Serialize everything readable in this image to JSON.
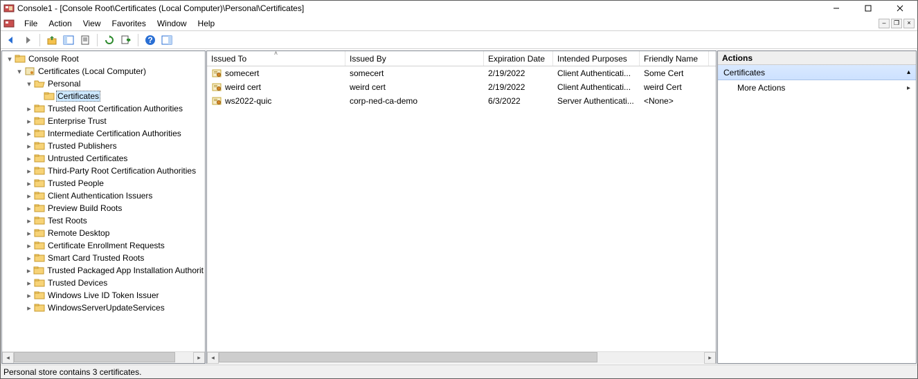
{
  "window": {
    "title": "Console1 - [Console Root\\Certificates (Local Computer)\\Personal\\Certificates]"
  },
  "menu": {
    "file": "File",
    "action": "Action",
    "view": "View",
    "favorites": "Favorites",
    "window": "Window",
    "help": "Help"
  },
  "tree": {
    "root": "Console Root",
    "certs_local": "Certificates (Local Computer)",
    "personal": "Personal",
    "certificates": "Certificates",
    "nodes": [
      "Trusted Root Certification Authorities",
      "Enterprise Trust",
      "Intermediate Certification Authorities",
      "Trusted Publishers",
      "Untrusted Certificates",
      "Third-Party Root Certification Authorities",
      "Trusted People",
      "Client Authentication Issuers",
      "Preview Build Roots",
      "Test Roots",
      "Remote Desktop",
      "Certificate Enrollment Requests",
      "Smart Card Trusted Roots",
      "Trusted Packaged App Installation Authorit",
      "Trusted Devices",
      "Windows Live ID Token Issuer",
      "WindowsServerUpdateServices"
    ]
  },
  "columns": {
    "issued_to": "Issued To",
    "issued_by": "Issued By",
    "expiration_date": "Expiration Date",
    "intended_purposes": "Intended Purposes",
    "friendly_name": "Friendly Name"
  },
  "rows": [
    {
      "issued_to": "somecert",
      "issued_by": "somecert",
      "expiration_date": "2/19/2022",
      "intended_purposes": "Client Authenticati...",
      "friendly_name": "Some Cert"
    },
    {
      "issued_to": "weird cert",
      "issued_by": "weird cert",
      "expiration_date": "2/19/2022",
      "intended_purposes": "Client Authenticati...",
      "friendly_name": "weird Cert"
    },
    {
      "issued_to": "ws2022-quic",
      "issued_by": "corp-ned-ca-demo",
      "expiration_date": "6/3/2022",
      "intended_purposes": "Server Authenticati...",
      "friendly_name": "<None>"
    }
  ],
  "actions": {
    "header": "Actions",
    "group": "Certificates",
    "more": "More Actions"
  },
  "status": "Personal store contains 3 certificates."
}
